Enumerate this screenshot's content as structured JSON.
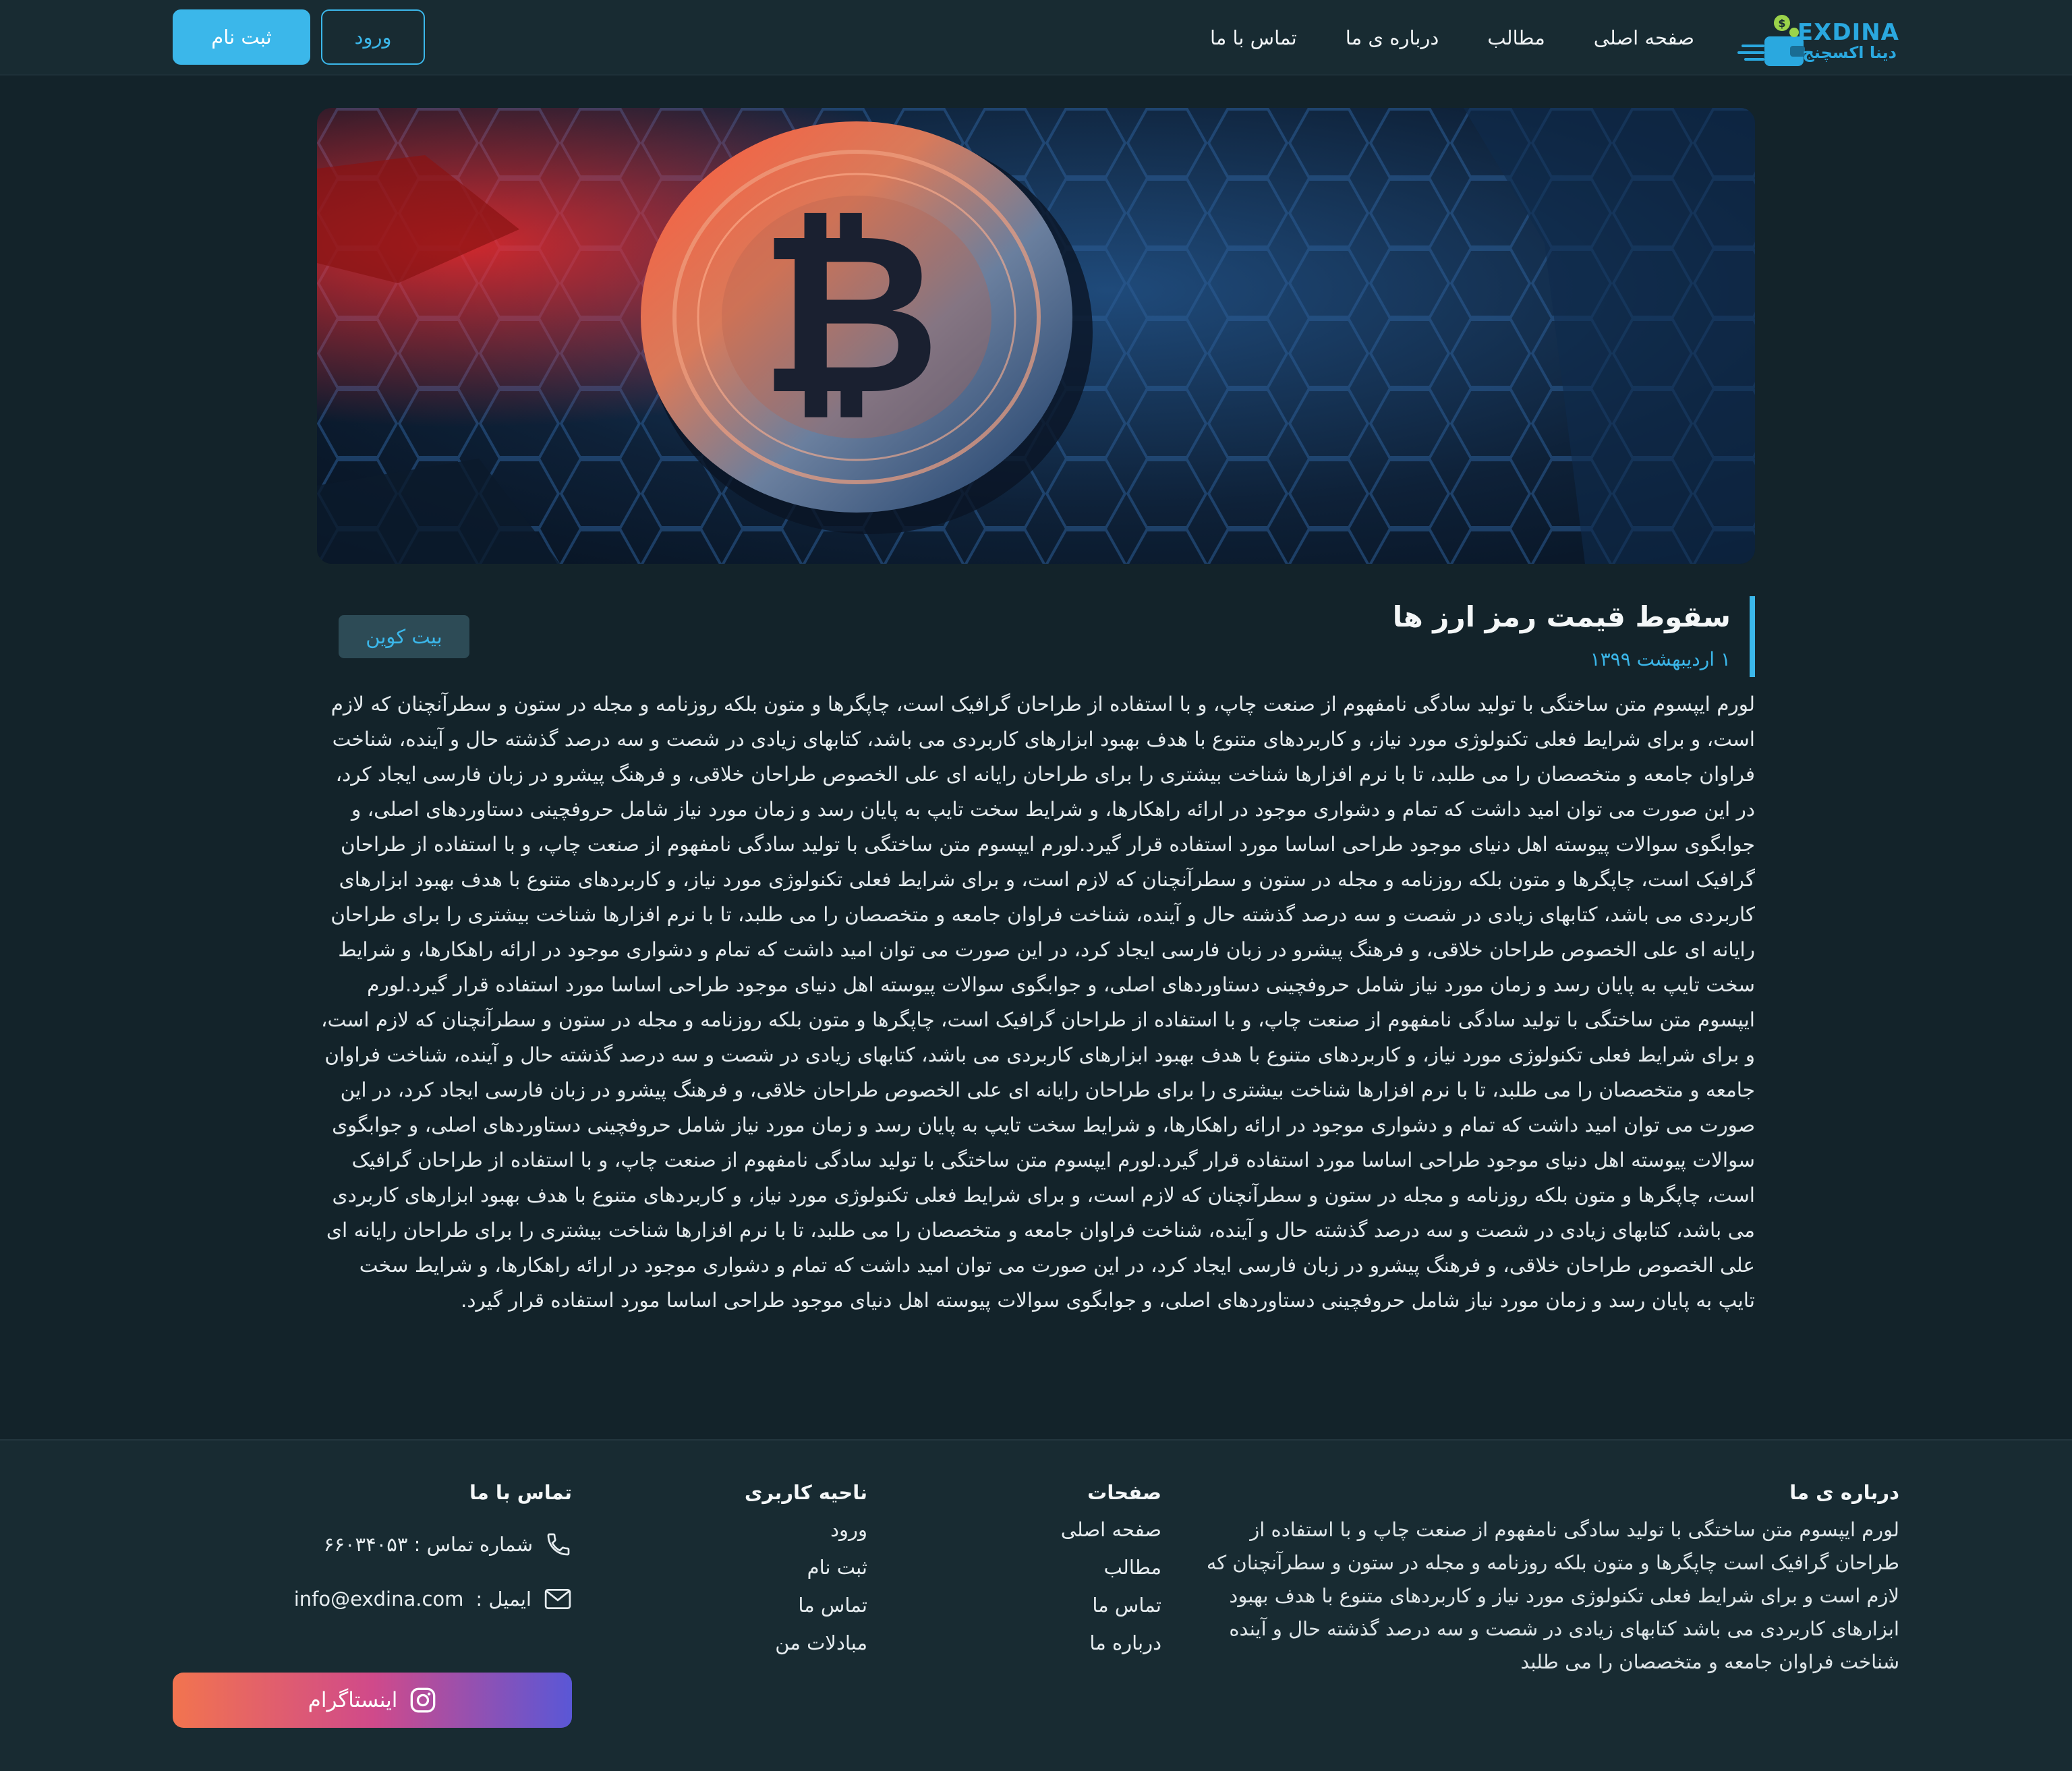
{
  "brand": {
    "name_en": "EXDINA",
    "name_fa": "دینا اکسچنج"
  },
  "nav": {
    "items": [
      {
        "label": "صفحه اصلی"
      },
      {
        "label": "مطالب"
      },
      {
        "label": "درباره ی ما"
      },
      {
        "label": "تماس با ما"
      }
    ],
    "login_label": "ورود",
    "register_label": "ثبت نام"
  },
  "article": {
    "title": "سقوط قیمت رمز ارز ها",
    "date": "۱ اردیبهشت ۱۳۹۹",
    "tag": "بیت کوین",
    "body": "لورم ایپسوم متن ساختگی با تولید سادگی نامفهوم از صنعت چاپ، و با استفاده از طراحان گرافیک است، چاپگرها و متون بلکه روزنامه و مجله در ستون و سطرآنچنان که لازم است، و برای شرایط فعلی تکنولوژی مورد نیاز، و کاربردهای متنوع با هدف بهبود ابزارهای کاربردی می باشد، کتابهای زیادی در شصت و سه درصد گذشته حال و آینده، شناخت فراوان جامعه و متخصصان را می طلبد، تا با نرم افزارها شناخت بیشتری را برای طراحان رایانه ای علی الخصوص طراحان خلاقی، و فرهنگ پیشرو در زبان فارسی ایجاد کرد، در این صورت می توان امید داشت که تمام و دشواری موجود در ارائه راهکارها، و شرایط سخت تایپ به پایان رسد و زمان مورد نیاز شامل حروفچینی دستاوردهای اصلی، و جوابگوی سوالات پیوسته اهل دنیای موجود طراحی اساسا مورد استفاده قرار گیرد.لورم ایپسوم متن ساختگی با تولید سادگی نامفهوم از صنعت چاپ، و با استفاده از طراحان گرافیک است، چاپگرها و متون بلکه روزنامه و مجله در ستون و سطرآنچنان که لازم است، و برای شرایط فعلی تکنولوژی مورد نیاز، و کاربردهای متنوع با هدف بهبود ابزارهای کاربردی می باشد، کتابهای زیادی در شصت و سه درصد گذشته حال و آینده، شناخت فراوان جامعه و متخصصان را می طلبد، تا با نرم افزارها شناخت بیشتری را برای طراحان رایانه ای علی الخصوص طراحان خلاقی، و فرهنگ پیشرو در زبان فارسی ایجاد کرد، در این صورت می توان امید داشت که تمام و دشواری موجود در ارائه راهکارها، و شرایط سخت تایپ به پایان رسد و زمان مورد نیاز شامل حروفچینی دستاوردهای اصلی، و جوابگوی سوالات پیوسته اهل دنیای موجود طراحی اساسا مورد استفاده قرار گیرد.لورم ایپسوم متن ساختگی با تولید سادگی نامفهوم از صنعت چاپ، و با استفاده از طراحان گرافیک است، چاپگرها و متون بلکه روزنامه و مجله در ستون و سطرآنچنان که لازم است، و برای شرایط فعلی تکنولوژی مورد نیاز، و کاربردهای متنوع با هدف بهبود ابزارهای کاربردی می باشد، کتابهای زیادی در شصت و سه درصد گذشته حال و آینده، شناخت فراوان جامعه و متخصصان را می طلبد، تا با نرم افزارها شناخت بیشتری را برای طراحان رایانه ای علی الخصوص طراحان خلاقی، و فرهنگ پیشرو در زبان فارسی ایجاد کرد، در این صورت می توان امید داشت که تمام و دشواری موجود در ارائه راهکارها، و شرایط سخت تایپ به پایان رسد و زمان مورد نیاز شامل حروفچینی دستاوردهای اصلی، و جوابگوی سوالات پیوسته اهل دنیای موجود طراحی اساسا مورد استفاده قرار گیرد.لورم ایپسوم متن ساختگی با تولید سادگی نامفهوم از صنعت چاپ، و با استفاده از طراحان گرافیک است، چاپگرها و متون بلکه روزنامه و مجله در ستون و سطرآنچنان که لازم است، و برای شرایط فعلی تکنولوژی مورد نیاز، و کاربردهای متنوع با هدف بهبود ابزارهای کاربردی می باشد، کتابهای زیادی در شصت و سه درصد گذشته حال و آینده، شناخت فراوان جامعه و متخصصان را می طلبد، تا با نرم افزارها شناخت بیشتری را برای طراحان رایانه ای علی الخصوص طراحان خلاقی، و فرهنگ پیشرو در زبان فارسی ایجاد کرد، در این صورت می توان امید داشت که تمام و دشواری موجود در ارائه راهکارها، و شرایط سخت تایپ به پایان رسد و زمان مورد نیاز شامل حروفچینی دستاوردهای اصلی، و جوابگوی سوالات پیوسته اهل دنیای موجود طراحی اساسا مورد استفاده قرار گیرد."
  },
  "footer": {
    "about": {
      "title": "درباره ی ما",
      "text": "لورم ایپسوم متن ساختگی با تولید سادگی نامفهوم از صنعت چاپ و با استفاده از طراحان گرافیک است چاپگرها و متون بلکه روزنامه و مجله در ستون و سطرآنچنان که لازم است و برای شرایط فعلی تکنولوژی مورد نیاز و کاربردهای متنوع با هدف بهبود ابزارهای کاربردی می باشد کتابهای زیادی در شصت و سه درصد گذشته حال و آینده شناخت فراوان جامعه و متخصصان را می طلبد"
    },
    "pages": {
      "title": "صفحات",
      "links": [
        "صفحه اصلی",
        "مطالب",
        "تماس ما",
        "درباره ما"
      ]
    },
    "user_area": {
      "title": "ناحیه کاربری",
      "links": [
        "ورود",
        "ثبت نام",
        "تماس ما",
        "مبادلات من"
      ]
    },
    "contact": {
      "title": "تماس با ما",
      "phone": "شماره تماس : ۶۶۰۳۴۰۵۳",
      "email_label": "ایمیل : ",
      "email": "info@exdina.com",
      "instagram_label": "اینستاگرام"
    }
  },
  "icons": {
    "phone": "phone-icon",
    "email": "envelope-icon",
    "instagram": "instagram-icon"
  },
  "colors": {
    "accent": "#3bb7ea",
    "background": "#13232a",
    "header": "#182b32",
    "tag_bg": "#2d4b56"
  }
}
